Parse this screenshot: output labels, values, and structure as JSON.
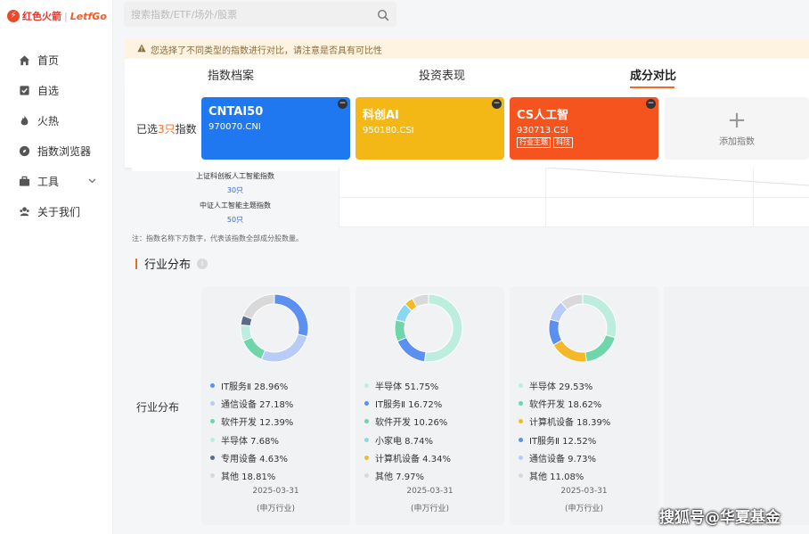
{
  "logo": {
    "mark": "⚡",
    "cn": "红色火箭",
    "sep": "|",
    "en": "LetfGo"
  },
  "sidebar": {
    "items": [
      {
        "label": "首页",
        "icon": "home-icon"
      },
      {
        "label": "自选",
        "icon": "checkbox-icon"
      },
      {
        "label": "火热",
        "icon": "flame-icon"
      },
      {
        "label": "指数浏览器",
        "icon": "compass-icon"
      },
      {
        "label": "工具",
        "icon": "toolbox-icon"
      },
      {
        "label": "关于我们",
        "icon": "team-icon"
      }
    ]
  },
  "search": {
    "placeholder": "搜索指数/ETF/场外/股票"
  },
  "warning": {
    "text": "您选择了不同类型的指数进行对比，请注意是否具有可比性"
  },
  "tabs": [
    {
      "label": "指数档案"
    },
    {
      "label": "投资表现"
    },
    {
      "label": "成分对比"
    }
  ],
  "selected": {
    "prefix": "已选",
    "count": "3只",
    "suffix": "指数"
  },
  "cards": [
    {
      "name": "CNTAI50",
      "code": "970070.CNI",
      "color": "#1f78f0",
      "tags": []
    },
    {
      "name": "科创AI",
      "code": "950180.CSI",
      "color": "#f4b816",
      "tags": []
    },
    {
      "name": "CS人工智",
      "code": "930713.CSI",
      "color": "#f5541f",
      "tags": [
        "行业主题",
        "科技"
      ]
    }
  ],
  "remove_glyph": "−",
  "add": {
    "plus": "+",
    "label": "添加指数"
  },
  "table": {
    "rows": [
      {
        "name": "上证科创板人工智能指数",
        "count": "30只"
      },
      {
        "name": "中证人工智能主题指数",
        "count": "50只"
      }
    ]
  },
  "note": "注：指数名称下方数字，代表该指数全部成分股数量。",
  "section": {
    "title": "行业分布",
    "info": "i",
    "row_label": "行业分布"
  },
  "industry_cards": [
    {
      "date": "2025-03-31",
      "source": "(申万行业)",
      "items": [
        {
          "label": "IT服务Ⅱ 28.96%",
          "value": 28.96,
          "color": "#5b8ff0"
        },
        {
          "label": "通信设备 27.18%",
          "value": 27.18,
          "color": "#b7ccf7"
        },
        {
          "label": "软件开发 12.39%",
          "value": 12.39,
          "color": "#6ed6a9"
        },
        {
          "label": "半导体 7.68%",
          "value": 7.68,
          "color": "#bdeedd"
        },
        {
          "label": "专用设备 4.63%",
          "value": 4.63,
          "color": "#5b6b8c"
        },
        {
          "label": "其他 18.81%",
          "value": 18.81,
          "color": "#d9d9d9"
        }
      ]
    },
    {
      "date": "2025-03-31",
      "source": "(申万行业)",
      "items": [
        {
          "label": "半导体 51.75%",
          "value": 51.75,
          "color": "#bdeedd"
        },
        {
          "label": "IT服务Ⅱ 16.72%",
          "value": 16.72,
          "color": "#5b8ff0"
        },
        {
          "label": "软件开发 10.26%",
          "value": 10.26,
          "color": "#6ed6a9"
        },
        {
          "label": "小家电 8.74%",
          "value": 8.74,
          "color": "#8ad8f0"
        },
        {
          "label": "计算机设备 4.34%",
          "value": 4.34,
          "color": "#f5b828"
        },
        {
          "label": "其他 7.97%",
          "value": 7.97,
          "color": "#d9d9d9"
        }
      ]
    },
    {
      "date": "2025-03-31",
      "source": "(申万行业)",
      "items": [
        {
          "label": "半导体 29.53%",
          "value": 29.53,
          "color": "#bdeedd"
        },
        {
          "label": "软件开发 18.62%",
          "value": 18.62,
          "color": "#6ed6a9"
        },
        {
          "label": "计算机设备 18.39%",
          "value": 18.39,
          "color": "#f5b828"
        },
        {
          "label": "IT服务Ⅱ 12.52%",
          "value": 12.52,
          "color": "#5b8ff0"
        },
        {
          "label": "通信设备 9.73%",
          "value": 9.73,
          "color": "#b7ccf7"
        },
        {
          "label": "其他 11.08%",
          "value": 11.08,
          "color": "#d9d9d9"
        }
      ]
    }
  ],
  "watermark": "搜狐号@华夏基金"
}
